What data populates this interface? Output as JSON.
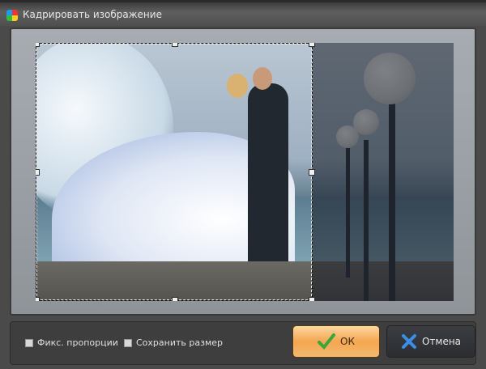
{
  "window": {
    "title": "Кадрировать изображение"
  },
  "options": {
    "fix_proportions": "Фикс. пропорции",
    "keep_size": "Сохранить размер"
  },
  "buttons": {
    "ok": "ОК",
    "cancel": "Отмена"
  }
}
